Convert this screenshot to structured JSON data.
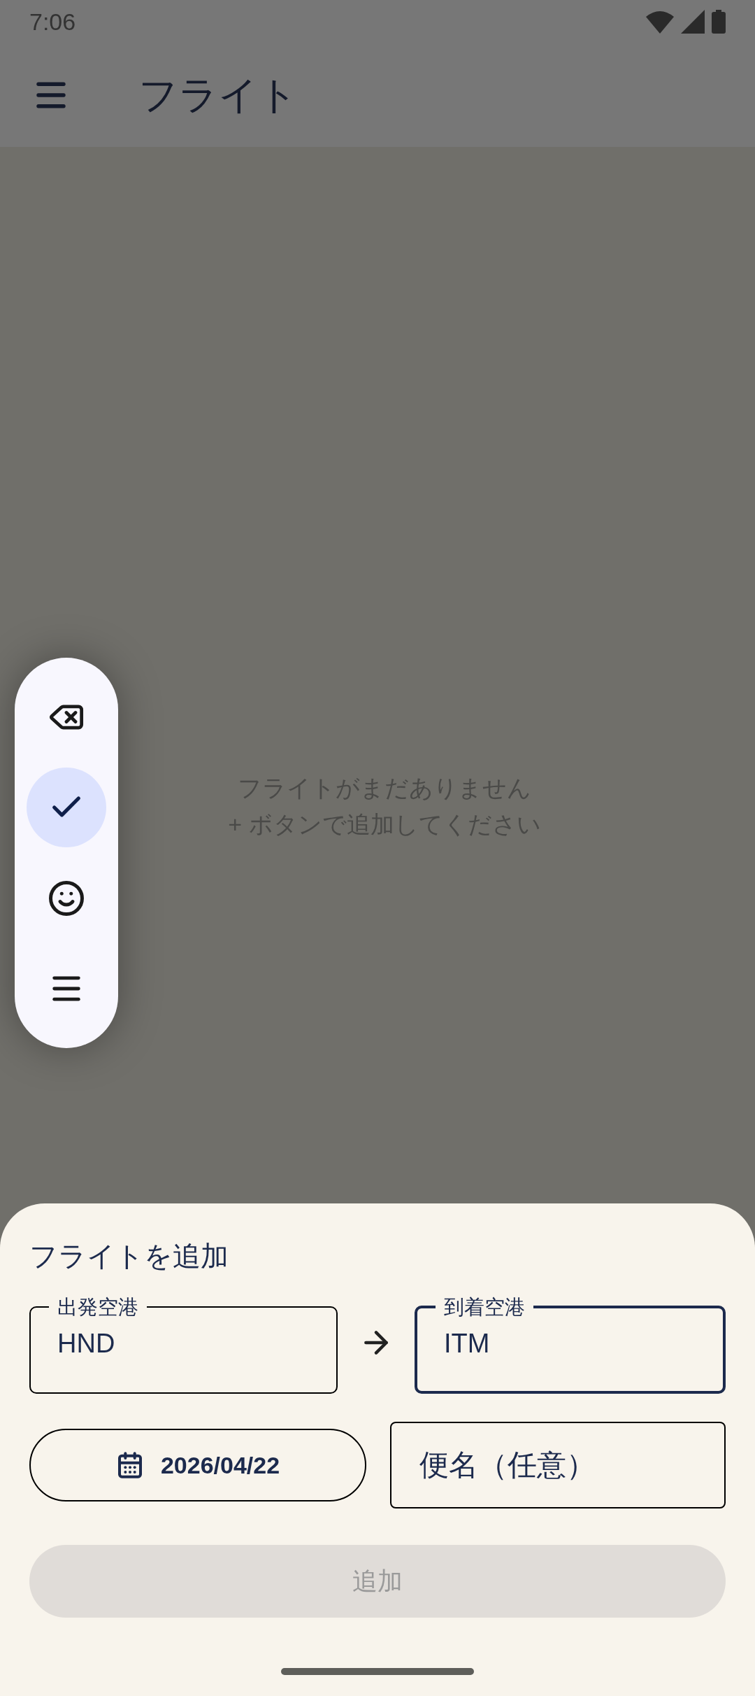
{
  "status_bar": {
    "time": "7:06"
  },
  "app_bar": {
    "title": "フライト"
  },
  "empty_state": {
    "lines": [
      "フライトがまだありません",
      "+ ボタンで追加してください"
    ]
  },
  "floating_toolbar": {
    "items": [
      {
        "kind": "backspace",
        "selected": false
      },
      {
        "kind": "check",
        "selected": true
      },
      {
        "kind": "emoji",
        "selected": false
      },
      {
        "kind": "menu",
        "selected": false
      }
    ]
  },
  "sheet": {
    "title": "フライトを追加",
    "departure": {
      "label": "出発空港",
      "value": "HND",
      "focused": false
    },
    "arrival": {
      "label": "到着空港",
      "value": "ITM",
      "focused": true
    },
    "date": {
      "value": "2026/04/22"
    },
    "flight_number": {
      "placeholder": "便名（任意）"
    },
    "add_button": {
      "label": "追加",
      "disabled": true
    }
  }
}
